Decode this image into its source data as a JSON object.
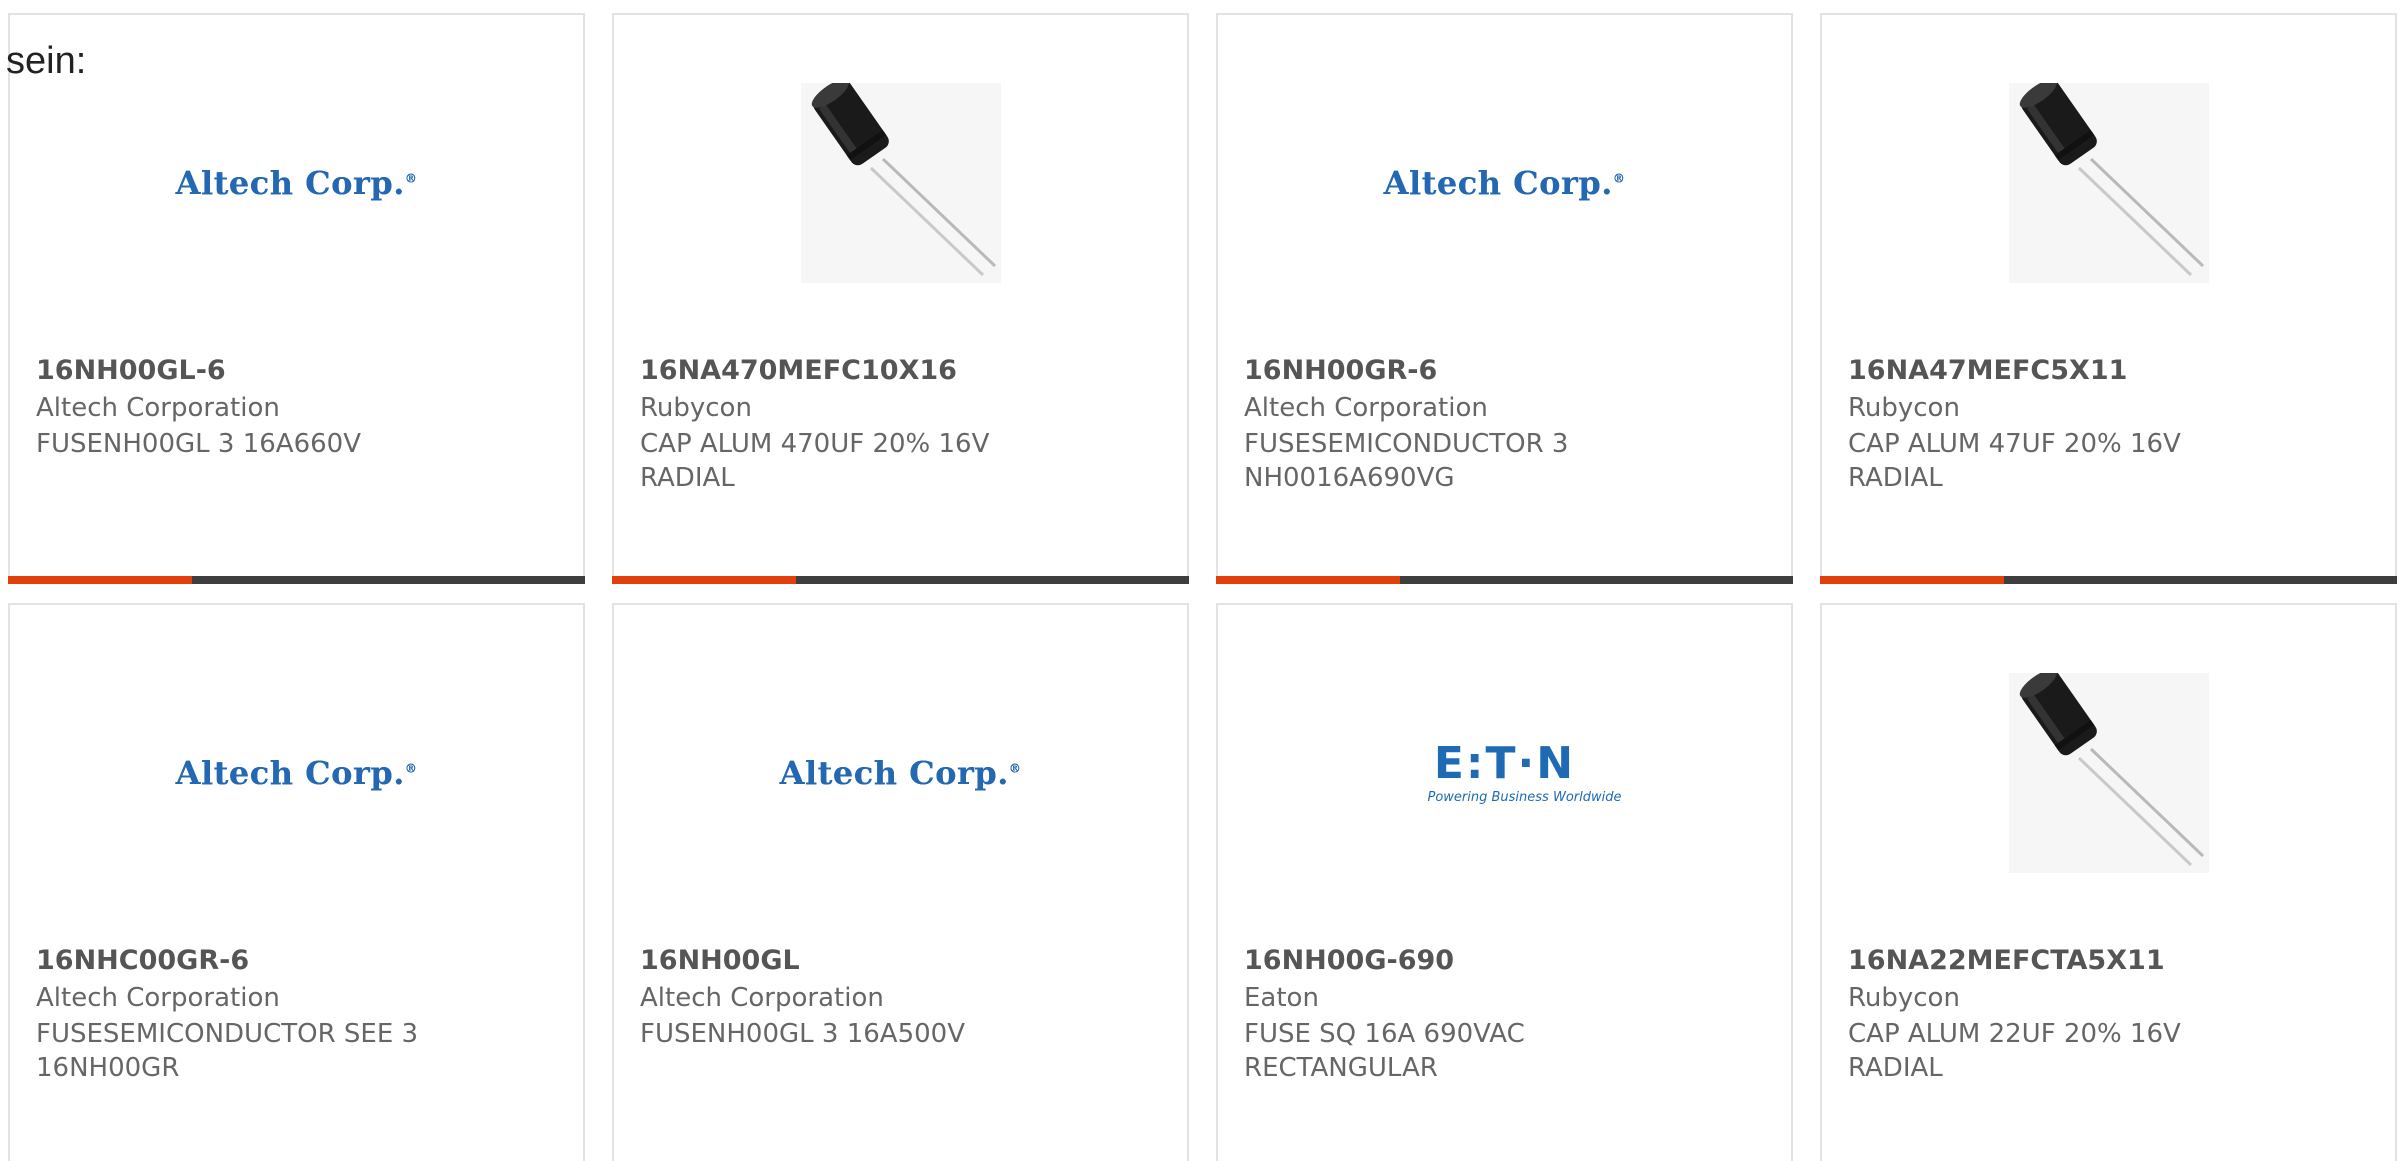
{
  "lead_text": "sein:",
  "products": [
    {
      "part_number": "16NH00GL-6",
      "manufacturer": "Altech Corporation",
      "description": "FUSENH00GL 3 16A660V",
      "image": "altech-logo"
    },
    {
      "part_number": "16NA470MEFC10X16",
      "manufacturer": "Rubycon",
      "description": "CAP ALUM 470UF 20% 16V RADIAL",
      "image": "capacitor-photo"
    },
    {
      "part_number": "16NH00GR-6",
      "manufacturer": "Altech Corporation",
      "description": "FUSESEMICONDUCTOR 3 NH0016A690VG",
      "image": "altech-logo"
    },
    {
      "part_number": "16NA47MEFC5X11",
      "manufacturer": "Rubycon",
      "description": "CAP ALUM 47UF 20% 16V RADIAL",
      "image": "capacitor-photo"
    },
    {
      "part_number": "16NHC00GR-6",
      "manufacturer": "Altech Corporation",
      "description": "FUSESEMICONDUCTOR SEE 3 16NH00GR",
      "image": "altech-logo"
    },
    {
      "part_number": "16NH00GL",
      "manufacturer": "Altech Corporation",
      "description": "FUSENH00GL 3 16A500V",
      "image": "altech-logo"
    },
    {
      "part_number": "16NH00G-690",
      "manufacturer": "Eaton",
      "description": "FUSE SQ 16A 690VAC RECTANGULAR",
      "image": "eaton-logo"
    },
    {
      "part_number": "16NA22MEFCTA5X11",
      "manufacturer": "Rubycon",
      "description": "CAP ALUM 22UF 20% 16V RADIAL",
      "image": "capacitor-photo"
    }
  ],
  "logos": {
    "altech": "Altech Corp.",
    "eaton": "E:T·N",
    "eaton_tagline": "Powering Business Worldwide"
  },
  "colors": {
    "accent": "#e2400a",
    "bar": "#3e3e3e",
    "altech_blue": "#2468b3",
    "eaton_blue": "#1e6ab5"
  }
}
